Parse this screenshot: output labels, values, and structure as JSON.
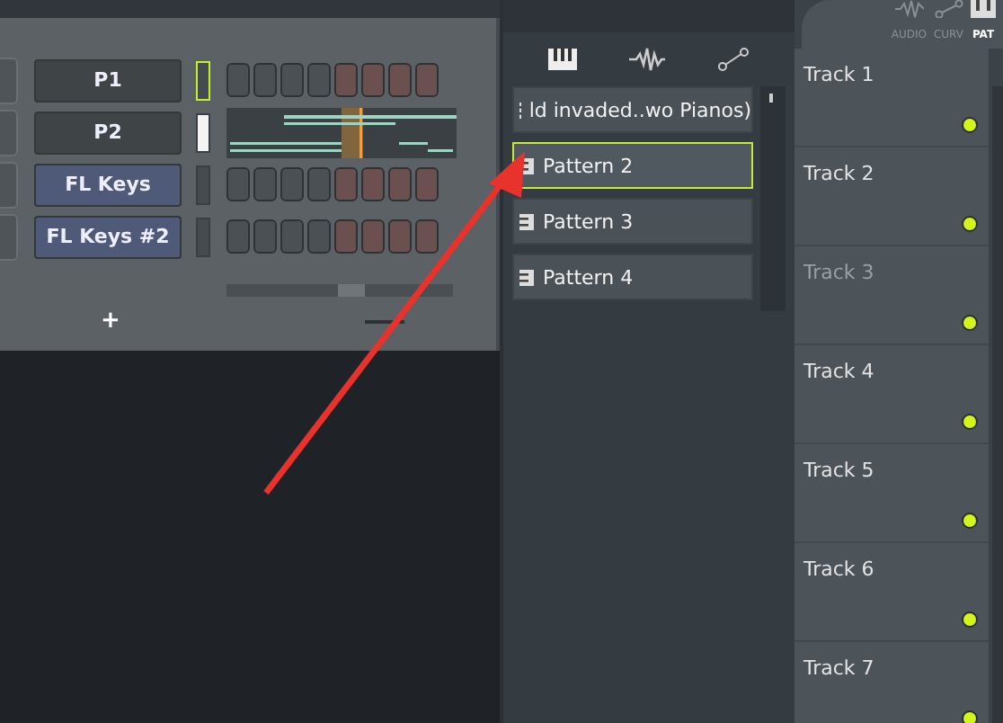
{
  "channel_rack": {
    "channels": [
      {
        "name": "P1",
        "kind": "steps",
        "focused": true,
        "selected": false,
        "color": "#3f4447"
      },
      {
        "name": "P2",
        "kind": "piano",
        "focused": false,
        "selected": true,
        "color": "#3f4447"
      },
      {
        "name": "FL Keys",
        "kind": "steps",
        "focused": false,
        "selected": false,
        "color": "#4e5a78"
      },
      {
        "name": "FL Keys #2",
        "kind": "steps",
        "focused": false,
        "selected": false,
        "color": "#4e5a78"
      }
    ],
    "add_button": "+"
  },
  "pattern_picker": {
    "patterns": [
      {
        "name": "ld invaded..wo Pianos)",
        "selected": false
      },
      {
        "name": "Pattern 2",
        "selected": true
      },
      {
        "name": "Pattern 3",
        "selected": false
      },
      {
        "name": "Pattern 4",
        "selected": false
      }
    ]
  },
  "playlist": {
    "filters": [
      {
        "label": "AUDIO"
      },
      {
        "label": "CURV"
      },
      {
        "label": "PAT"
      }
    ],
    "tracks": [
      {
        "name": "Track 1",
        "dimmed": false
      },
      {
        "name": "Track 2",
        "dimmed": false
      },
      {
        "name": "Track 3",
        "dimmed": true
      },
      {
        "name": "Track 4",
        "dimmed": false
      },
      {
        "name": "Track 5",
        "dimmed": false
      },
      {
        "name": "Track 6",
        "dimmed": false
      },
      {
        "name": "Track 7",
        "dimmed": false
      }
    ]
  }
}
